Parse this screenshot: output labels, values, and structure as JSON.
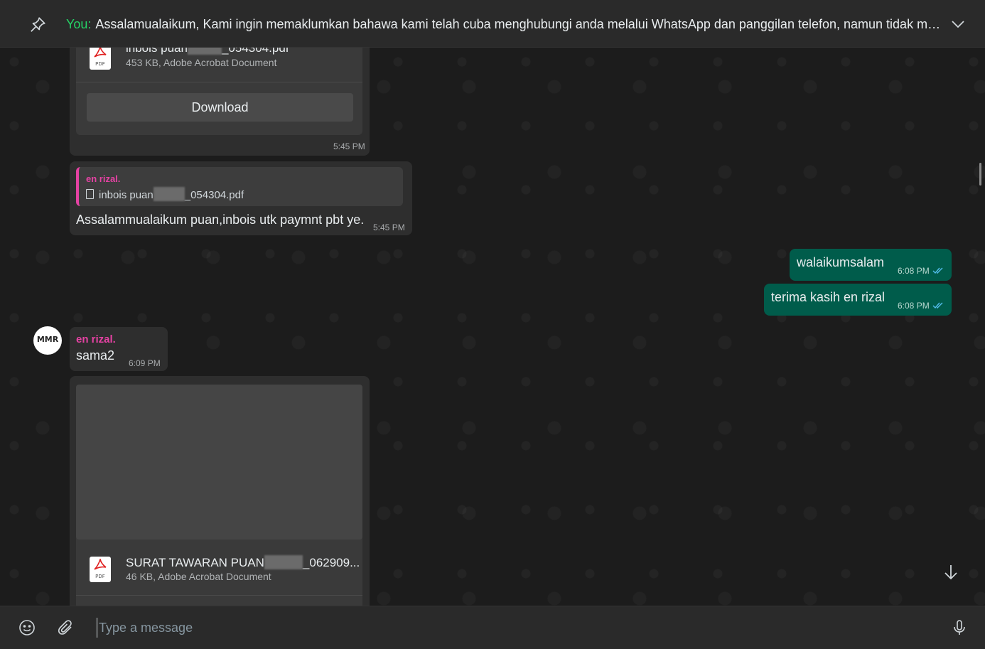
{
  "pinned": {
    "sender": "You:",
    "text": "Assalamualaikum,  Kami ingin memaklumkan bahawa kami telah cuba menghubungi anda melalui WhatsApp dan panggilan telefon, namun tidak mener..."
  },
  "messages": {
    "doc1": {
      "name_prefix": "inbois puan",
      "name_suffix": "_054304.pdf",
      "meta": "453 KB, Adobe Acrobat Document",
      "download_label": "Download",
      "time": "5:45 PM"
    },
    "reply1": {
      "quote_author": "en rizal.",
      "quote_prefix": "inbois puan",
      "quote_suffix": "_054304.pdf",
      "text": "Assalammualaikum puan,inbois utk paymnt pbt ye.",
      "time": "5:45 PM"
    },
    "out1": {
      "text": "walaikumsalam",
      "time": "6:08 PM"
    },
    "out2": {
      "text": "terima kasih en rizal",
      "time": "6:08 PM"
    },
    "in2": {
      "author": "en rizal.",
      "text": "sama2",
      "time": "6:09 PM",
      "avatar_text": "MMR"
    },
    "doc2": {
      "name_prefix": "SURAT TAWARAN PUAN",
      "name_suffix": "_062909...",
      "meta": "46 KB, Adobe Acrobat Document"
    }
  },
  "composer": {
    "placeholder": "Type a message"
  },
  "pdf_icon_label": "PDF",
  "colors": {
    "outgoing_bubble": "#005c4b",
    "incoming_bubble": "#2e2e2e",
    "author_color": "#e542a3",
    "you_color": "#25d366",
    "read_ticks": "#53bdeb"
  }
}
